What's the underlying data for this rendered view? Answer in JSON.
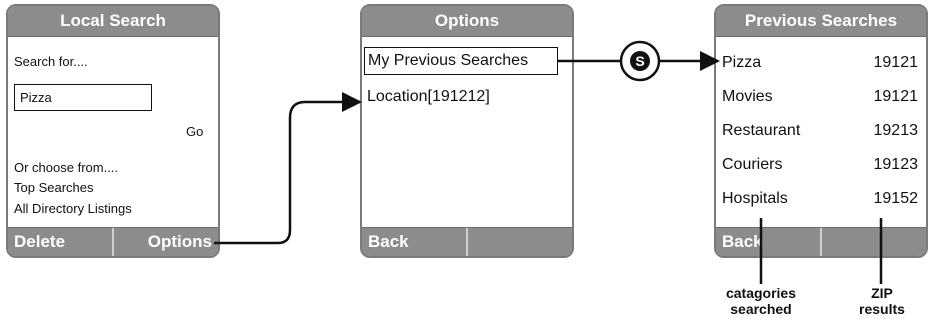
{
  "screen1": {
    "title": "Local Search",
    "prompt": "Search for....",
    "input_value": "Pizza",
    "go": "Go",
    "choose": "Or choose from....",
    "top": "Top Searches",
    "all": "All Directory Listings",
    "left_key": "Delete",
    "right_key": "Options"
  },
  "screen2": {
    "title": "Options",
    "items": [
      "My Previous Searches",
      "Location[191212]"
    ],
    "left_key": "Back",
    "right_key": ""
  },
  "screen3": {
    "title": "Previous Searches",
    "rows": [
      {
        "category": "Pizza",
        "zip": "19121"
      },
      {
        "category": "Movies",
        "zip": "19121"
      },
      {
        "category": "Restaurant",
        "zip": "19213"
      },
      {
        "category": "Couriers",
        "zip": "19123"
      },
      {
        "category": "Hospitals",
        "zip": "19152"
      }
    ],
    "left_key": "Back",
    "right_key": ""
  },
  "connector_symbol": "S",
  "annotations": {
    "categories": [
      "catagories",
      "searched"
    ],
    "zip": [
      "ZIP",
      "results"
    ]
  }
}
